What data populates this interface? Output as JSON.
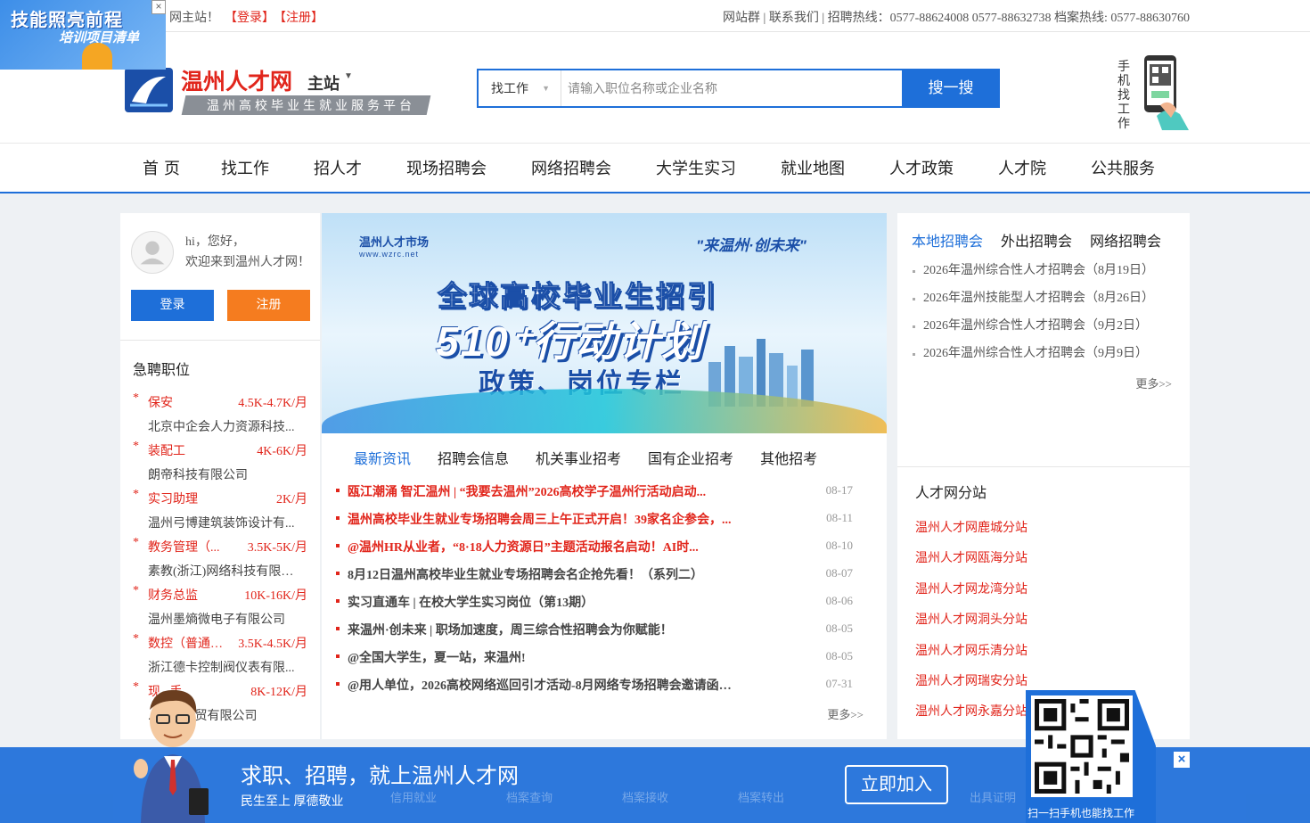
{
  "promo": {
    "line1": "技能照亮前程",
    "line2": "培训项目清单",
    "close": "×"
  },
  "topbar": {
    "welcome": "网主站！",
    "login": "【登录】",
    "register": "【注册】",
    "right": "网站群 | 联系我们 | 招聘热线：0577-88624008 0577-88632738 档案热线: 0577-88630760"
  },
  "header": {
    "site_name": "温州人才网",
    "site_sub": "主站",
    "slogan": "温州高校毕业生就业服务平台",
    "mobile_label": "手机找工作"
  },
  "search": {
    "type": "找工作",
    "placeholder": "请输入职位名称或企业名称",
    "button": "搜一搜"
  },
  "nav": [
    "首页",
    "找工作",
    "招人才",
    "现场招聘会",
    "网络招聘会",
    "大学生实习",
    "就业地图",
    "人才政策",
    "人才院",
    "公共服务"
  ],
  "user_panel": {
    "hi": "hi，您好，",
    "welcome": "欢迎来到温州人才网！",
    "login": "登录",
    "register": "注册"
  },
  "urgent": {
    "title": "急聘职位",
    "jobs": [
      {
        "name": "保安",
        "pay": "4.5K-4.7K/月",
        "company": "北京中企会人力资源科技..."
      },
      {
        "name": "装配工",
        "pay": "4K-6K/月",
        "company": "朗帝科技有限公司"
      },
      {
        "name": "实习助理",
        "pay": "2K/月",
        "company": "温州弓博建筑装饰设计有..."
      },
      {
        "name": "教务管理（...",
        "pay": "3.5K-5K/月",
        "company": "素教(浙江)网络科技有限公司"
      },
      {
        "name": "财务总监",
        "pay": "10K-16K/月",
        "company": "温州墨熵微电子有限公司"
      },
      {
        "name": "数控（普通）...",
        "pay": "3.5K-4.5K/月",
        "company": "浙江德卡控制阀仪表有限..."
      },
      {
        "name": "现...手",
        "pay": "8K-12K/月",
        "company": "...交流商贸有限公司"
      }
    ]
  },
  "banner": {
    "logo": "温州人才市场",
    "logo_url": "www.wzrc.net",
    "slogan": "\"来温州·创未来\"",
    "title1": "全球高校毕业生招引",
    "title2": "510⁺行动计划",
    "title3": "政策、岗位专栏"
  },
  "news": {
    "tabs": [
      "最新资讯",
      "招聘会信息",
      "机关事业招考",
      "国有企业招考",
      "其他招考"
    ],
    "items": [
      {
        "title": "瓯江潮涌 智汇温州 | “我要去温州”2026高校学子温州行活动启动...",
        "date": "08-17",
        "hot": true
      },
      {
        "title": "温州高校毕业生就业专场招聘会周三上午正式开启！39家名企参会，...",
        "date": "08-11",
        "hot": true
      },
      {
        "title": "@温州HR从业者，“8·18人力资源日”主题活动报名启动！AI时...",
        "date": "08-10",
        "hot": true
      },
      {
        "title": "8月12日温州高校毕业生就业专场招聘会名企抢先看！（系列二）",
        "date": "08-07",
        "hot": false
      },
      {
        "title": "实习直通车 | 在校大学生实习岗位（第13期）",
        "date": "08-06",
        "hot": false
      },
      {
        "title": "来温州·创未来 | 职场加速度，周三综合性招聘会为你赋能！",
        "date": "08-05",
        "hot": false
      },
      {
        "title": "@全国大学生，夏一站，来温州!",
        "date": "08-05",
        "hot": false
      },
      {
        "title": "@用人单位，2026高校网络巡回引才活动-8月网络专场招聘会邀请函请...",
        "date": "07-31",
        "hot": false
      }
    ],
    "more": "更多>>"
  },
  "fairs": {
    "tabs": [
      "本地招聘会",
      "外出招聘会",
      "网络招聘会"
    ],
    "items": [
      "2026年温州综合性人才招聘会（8月19日）",
      "2026年温州技能型人才招聘会（8月26日）",
      "2026年温州综合性人才招聘会（9月2日）",
      "2026年温州综合性人才招聘会（9月9日）"
    ],
    "more": "更多>>"
  },
  "branches": {
    "title": "人才网分站",
    "items": [
      "温州人才网鹿城分站",
      "温州人才网瓯海分站",
      "温州人才网龙湾分站",
      "温州人才网洞头分站",
      "温州人才网乐清分站",
      "温州人才网瑞安分站",
      "温州人才网永嘉分站"
    ]
  },
  "qr_float": {
    "caption": "扫一扫手机也能找工作"
  },
  "bottom_bar": {
    "headline": "求职、招聘，就上温州人才网",
    "tagline": "民生至上 厚德敬业",
    "join": "立即加入",
    "close": "×",
    "ghost_items": [
      "信用就业",
      "档案查询",
      "档案接收",
      "档案转出",
      "出具证明"
    ]
  },
  "colors": {
    "brand_blue": "#1e6fd9",
    "accent_red": "#e1251b",
    "register_orange": "#f57c1f"
  }
}
